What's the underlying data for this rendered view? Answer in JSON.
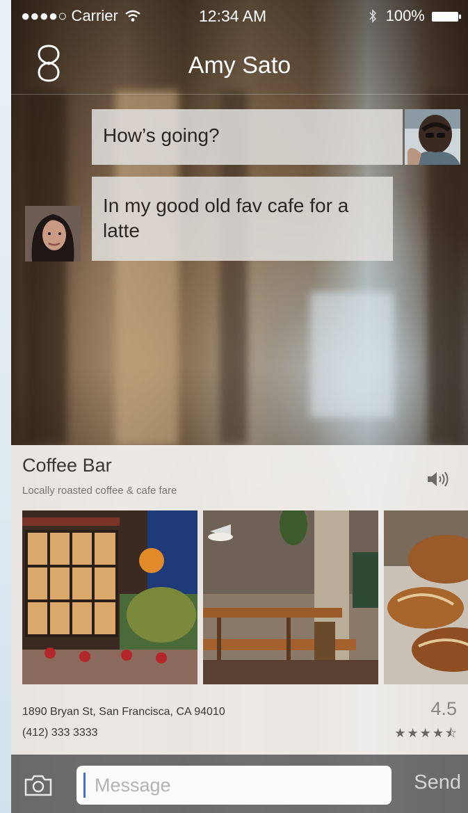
{
  "status_bar": {
    "carrier": "●●●●○ Carrier",
    "time": "12:34 AM",
    "battery": "100%"
  },
  "nav": {
    "title": "Amy Sato",
    "logo_icon": "link-logo-icon"
  },
  "messages": [
    {
      "text": "How’s going?",
      "sender": "outgoing"
    },
    {
      "text": "In my good old fav cafe for a latte",
      "sender": "incoming"
    }
  ],
  "place_card": {
    "name": "Coffee Bar",
    "description": "Locally roasted coffee & cafe fare",
    "address": "1890 Bryan St, San Francisca, CA 94010",
    "phone": "(412) 333 3333",
    "rating": "4.5",
    "stars": "★★★★⯪",
    "rating_value": 4.5,
    "rating_max": 5,
    "speaker_icon": "speaker-icon"
  },
  "composer": {
    "placeholder": "Message",
    "send_label": "Send",
    "camera_icon": "camera-icon"
  },
  "colors": {
    "bubble": "#e1dedc",
    "card": "#f4f2f0",
    "composer": "#6e6e70",
    "cursor": "#3b6fd9"
  }
}
